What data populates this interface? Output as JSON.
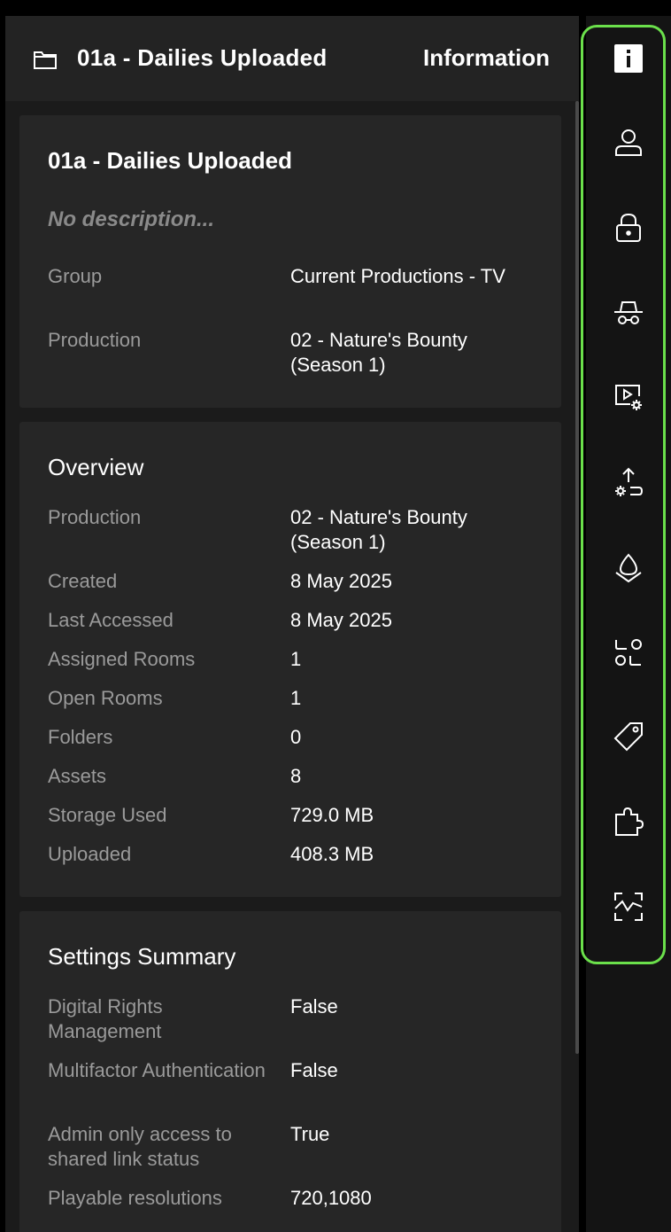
{
  "header": {
    "title": "01a - Dailies Uploaded",
    "panel_label": "Information",
    "folder_icon": "folder-icon"
  },
  "info_card": {
    "title": "01a - Dailies Uploaded",
    "description": "No description...",
    "rows": [
      {
        "label": "Group",
        "value": "Current Productions - TV"
      },
      {
        "label": "Production",
        "value": "02 - Nature's Bounty (Season 1)"
      }
    ]
  },
  "overview": {
    "title": "Overview",
    "rows": [
      {
        "label": "Production",
        "value": "02 - Nature's Bounty (Season 1)"
      },
      {
        "label": "Created",
        "value": "8 May 2025"
      },
      {
        "label": "Last Accessed",
        "value": "8 May 2025"
      },
      {
        "label": "Assigned Rooms",
        "value": "1"
      },
      {
        "label": "Open Rooms",
        "value": "1"
      },
      {
        "label": "Folders",
        "value": "0"
      },
      {
        "label": "Assets",
        "value": "8"
      },
      {
        "label": "Storage Used",
        "value": "729.0 MB"
      },
      {
        "label": "Uploaded",
        "value": "408.3 MB"
      }
    ]
  },
  "settings": {
    "title": "Settings Summary",
    "rows": [
      {
        "label": "Digital Rights Management",
        "value": "False"
      },
      {
        "label": "Multifactor Authentication",
        "value": "False"
      },
      {
        "label": "Admin only access to shared link status",
        "value": "True"
      },
      {
        "label": "Playable resolutions",
        "value": "720,1080"
      }
    ]
  },
  "rail": {
    "highlight_color": "#6be04b",
    "icons": [
      "info-icon",
      "user-icon",
      "lock-icon",
      "incognito-icon",
      "video-settings-icon",
      "upload-settings-icon",
      "watermark-icon",
      "options-icon",
      "tag-icon",
      "puzzle-icon",
      "activity-icon"
    ]
  }
}
